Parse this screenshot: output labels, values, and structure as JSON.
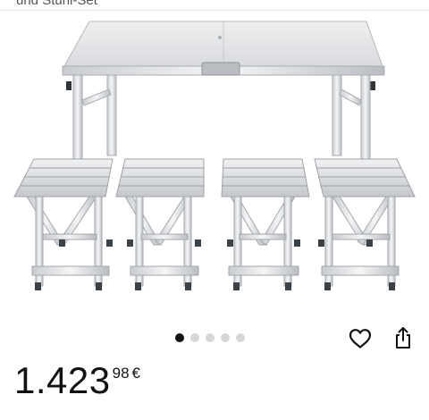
{
  "header": {
    "caption": "und Stuhl-Set"
  },
  "product": {
    "image_icon": "folding-table-with-four-stools-image"
  },
  "carousel": {
    "total": 5,
    "active_index": 1,
    "active_color": "#111111",
    "inactive_color": "#d7d7d7"
  },
  "actions": {
    "favorite_icon": "heart-icon",
    "share_icon": "share-icon"
  },
  "price": {
    "main": "1.423",
    "cents": "98",
    "currency": "€"
  }
}
